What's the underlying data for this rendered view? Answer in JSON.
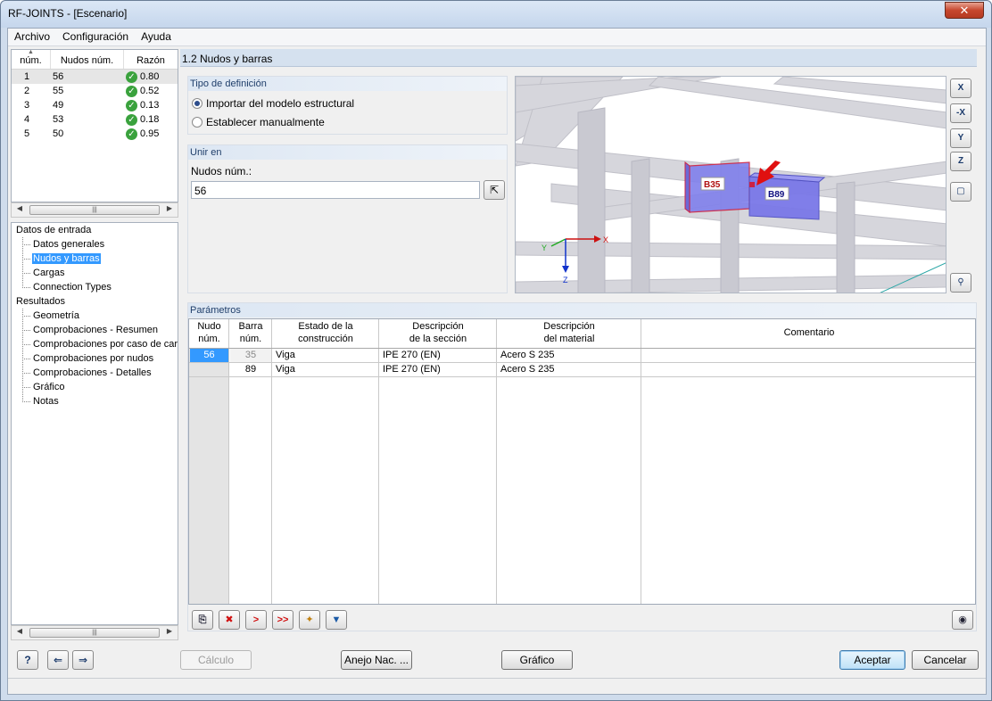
{
  "window": {
    "title": "RF-JOINTS - [Escenario]",
    "close_label": "✕"
  },
  "menu": [
    "Archivo",
    "Configuración",
    "Ayuda"
  ],
  "nodes_list": {
    "headers": [
      "núm.",
      "Nudos núm.",
      "Razón"
    ],
    "rows": [
      {
        "num": "1",
        "node": "56",
        "ratio": "0.80"
      },
      {
        "num": "2",
        "node": "55",
        "ratio": "0.52"
      },
      {
        "num": "3",
        "node": "49",
        "ratio": "0.13"
      },
      {
        "num": "4",
        "node": "53",
        "ratio": "0.18"
      },
      {
        "num": "5",
        "node": "50",
        "ratio": "0.95"
      }
    ]
  },
  "tree": {
    "input_root": "Datos de entrada",
    "input_items": [
      "Datos generales",
      "Nudos y barras",
      "Cargas",
      "Connection Types"
    ],
    "results_root": "Resultados",
    "results_items": [
      "Geometría",
      "Comprobaciones - Resumen",
      "Comprobaciones por caso de carg",
      "Comprobaciones por nudos",
      "Comprobaciones - Detalles",
      "Gráfico",
      "Notas"
    ]
  },
  "section_title": "1.2 Nudos y barras",
  "definition_type": {
    "title": "Tipo de definición",
    "option_import": "Importar del modelo estructural",
    "option_manual": "Establecer manualmente"
  },
  "join_in": {
    "title": "Unir en",
    "label": "Nudos núm.:",
    "value": "56"
  },
  "viewport": {
    "label_b35": "B35",
    "label_b89": "B89",
    "axis_x": "X",
    "axis_y": "Y",
    "axis_z": "Z"
  },
  "view_toolbar": [
    "X",
    "-X",
    "Y",
    "Z"
  ],
  "params": {
    "title": "Parámetros",
    "headers": [
      [
        "Nudo",
        "núm."
      ],
      [
        "Barra",
        "núm."
      ],
      [
        "Estado de la",
        "construcción"
      ],
      [
        "Descripción",
        "de la sección"
      ],
      [
        "Descripción",
        "del material"
      ],
      [
        "Comentario",
        ""
      ]
    ],
    "rows": [
      {
        "node": "56",
        "bar": "35",
        "state": "Viga",
        "section": "IPE 270 (EN)",
        "material": "Acero S 235",
        "comment": ""
      },
      {
        "node": "",
        "bar": "89",
        "state": "Viga",
        "section": "IPE 270 (EN)",
        "material": "Acero S 235",
        "comment": ""
      }
    ]
  },
  "buttons": {
    "calc": "Cálculo",
    "annex": "Anejo Nac. ...",
    "graphic": "Gráfico",
    "accept": "Aceptar",
    "cancel": "Cancelar"
  },
  "colors": {
    "selection": "#3399ff",
    "accent": "#d5e1ef",
    "ok": "#3aa23d",
    "highlight_member": "#7a78e8"
  }
}
